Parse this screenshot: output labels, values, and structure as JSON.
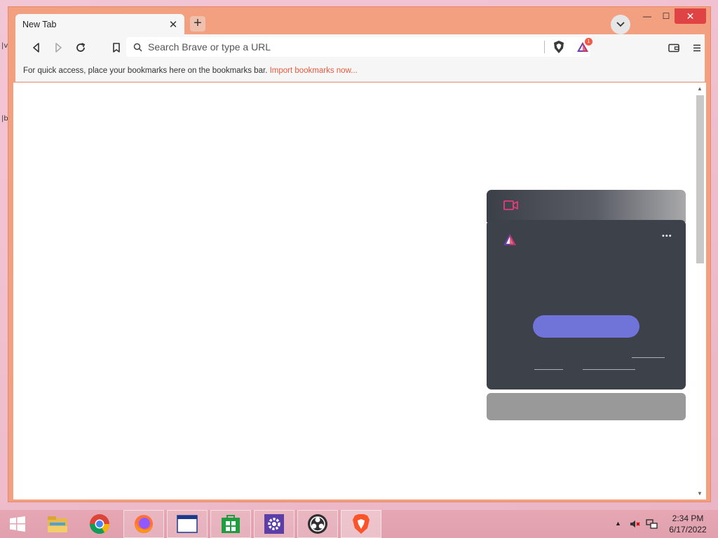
{
  "browser": {
    "tab_title": "New Tab",
    "tab_close": "✕",
    "new_tab": "+",
    "window_controls": {
      "minimize": "—",
      "maximize": "☐",
      "close": "✕"
    }
  },
  "toolbar": {
    "search_placeholder": "Search Brave or type a URL",
    "rewards_badge": "1"
  },
  "bookmarks_bar": {
    "message": "For quick access, place your bookmarks here on the bookmarks bar.",
    "import_link": "Import bookmarks now..."
  },
  "panel": {
    "more_label": "•••"
  },
  "taskbar": {
    "apps": [
      "windows-start",
      "file-explorer",
      "chrome",
      "firefox",
      "window-app",
      "store",
      "settings",
      "obs",
      "brave"
    ],
    "time": "2:34 PM",
    "date": "6/17/2022"
  },
  "colors": {
    "titlebar": "#f2a07f",
    "panel": "#3c414a",
    "cta": "#7074d8",
    "link": "#e55a3c"
  }
}
